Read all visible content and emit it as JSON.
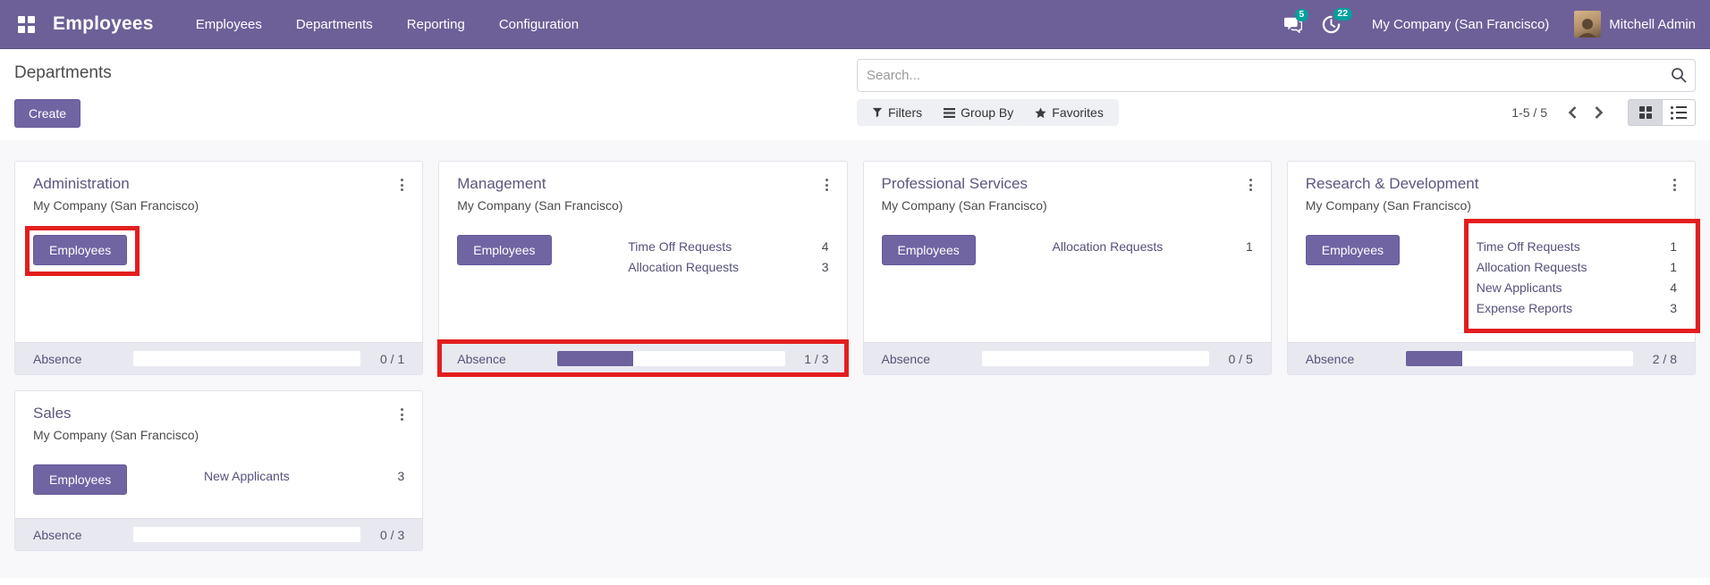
{
  "nav": {
    "brand": "Employees",
    "menu_items": [
      "Employees",
      "Departments",
      "Reporting",
      "Configuration"
    ],
    "messages_count": "5",
    "activities_count": "22",
    "company": "My Company (San Francisco)",
    "user": "Mitchell Admin"
  },
  "control_panel": {
    "title": "Departments",
    "create_label": "Create",
    "search_placeholder": "Search...",
    "filters_label": "Filters",
    "group_by_label": "Group By",
    "favorites_label": "Favorites",
    "pager": "1-5 / 5"
  },
  "cards": [
    {
      "title": "Administration",
      "company": "My Company (San Francisco)",
      "button_label": "Employees",
      "stats": [],
      "absence": {
        "label": "Absence",
        "value": 0,
        "max": 1,
        "display": "0 / 1"
      },
      "highlight": "button"
    },
    {
      "title": "Management",
      "company": "My Company (San Francisco)",
      "button_label": "Employees",
      "stats": [
        {
          "label": "Time Off Requests",
          "value": "4"
        },
        {
          "label": "Allocation Requests",
          "value": "3"
        }
      ],
      "absence": {
        "label": "Absence",
        "value": 1,
        "max": 3,
        "display": "1 / 3"
      },
      "highlight": "absence"
    },
    {
      "title": "Professional Services",
      "company": "My Company (San Francisco)",
      "button_label": "Employees",
      "stats": [
        {
          "label": "Allocation Requests",
          "value": "1"
        }
      ],
      "absence": {
        "label": "Absence",
        "value": 0,
        "max": 5,
        "display": "0 / 5"
      },
      "highlight": null
    },
    {
      "title": "Research & Development",
      "company": "My Company (San Francisco)",
      "button_label": "Employees",
      "stats": [
        {
          "label": "Time Off Requests",
          "value": "1"
        },
        {
          "label": "Allocation Requests",
          "value": "1"
        },
        {
          "label": "New Applicants",
          "value": "4"
        },
        {
          "label": "Expense Reports",
          "value": "3"
        }
      ],
      "absence": {
        "label": "Absence",
        "value": 2,
        "max": 8,
        "display": "2 / 8"
      },
      "highlight": "stats"
    },
    {
      "title": "Sales",
      "company": "My Company (San Francisco)",
      "button_label": "Employees",
      "stats": [
        {
          "label": "New Applicants",
          "value": "3"
        }
      ],
      "absence": {
        "label": "Absence",
        "value": 0,
        "max": 3,
        "display": "0 / 3"
      },
      "highlight": null
    }
  ],
  "colors": {
    "nav": "#6d6098",
    "accent": "#7064a3",
    "accent_border": "#665a99",
    "badge": "#00a09d",
    "link": "#55517b",
    "fill": "#6d619e",
    "red": "#e31e1e"
  }
}
